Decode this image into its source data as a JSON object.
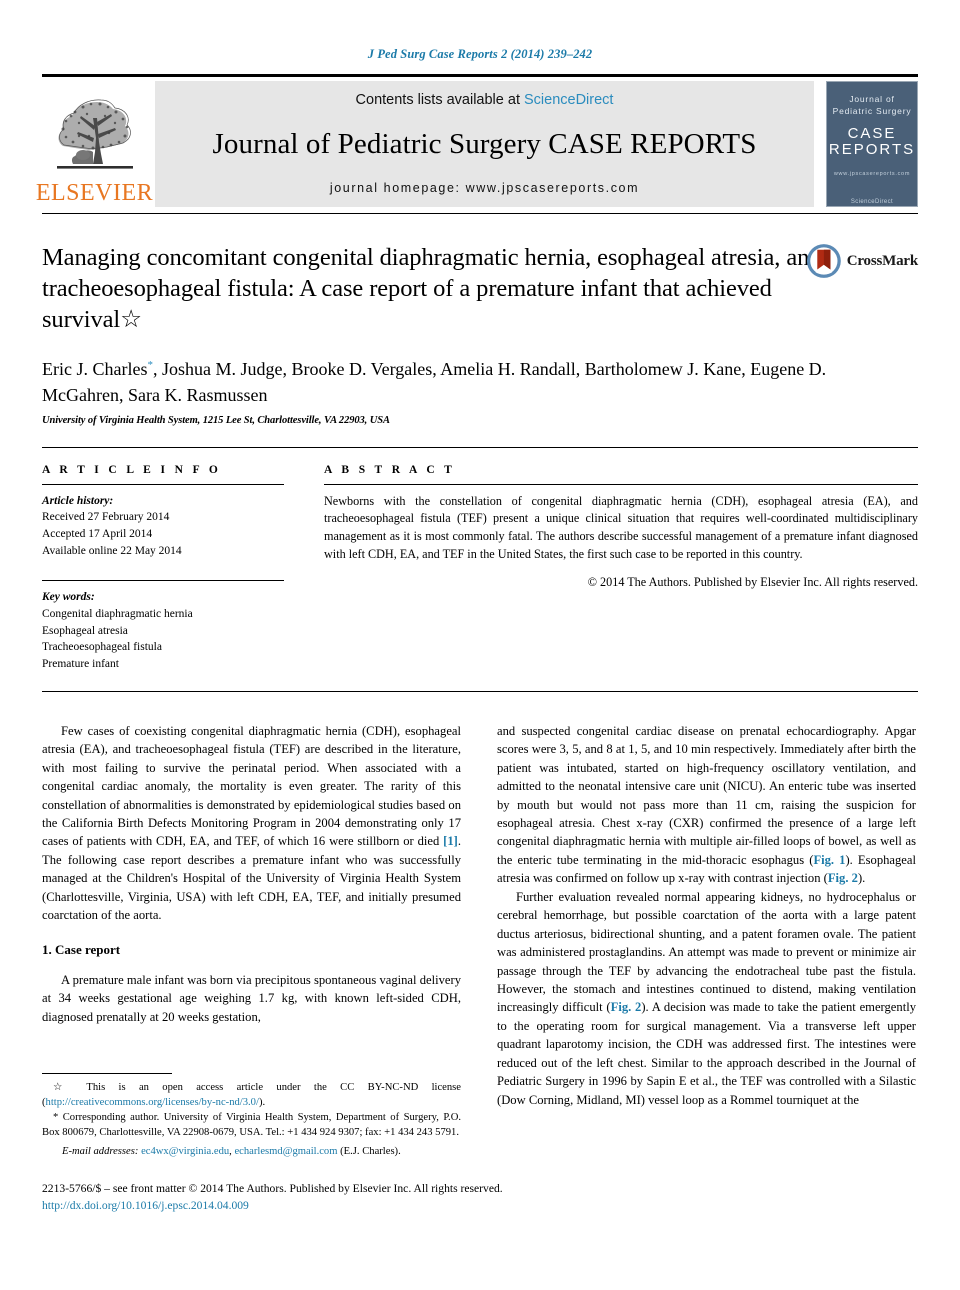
{
  "running_head": "J Ped Surg Case Reports 2 (2014) 239–242",
  "masthead": {
    "contents_prefix": "Contents lists available at ",
    "sciencedirect": "ScienceDirect",
    "journal_title": "Journal of Pediatric Surgery CASE REPORTS",
    "homepage": "journal homepage: www.jpscasereports.com",
    "publisher_name": "ELSEVIER",
    "cover": {
      "line1": "Journal of",
      "line2": "Pediatric Surgery",
      "case": "CASE",
      "reports": "REPORTS",
      "url": "www.jpscasereports.com",
      "sciencedirect": "ScienceDirect"
    },
    "accent_link_color": "#2b8cbe",
    "elsevier_orange": "#e87722",
    "cover_bg": "#4a6078"
  },
  "article": {
    "title": "Managing concomitant congenital diaphragmatic hernia, esophageal atresia, and tracheoesophageal fistula: A case report of a premature infant that achieved survival☆",
    "crossmark_label": "CrossMark",
    "authors": "Eric J. Charles*, Joshua M. Judge, Brooke D. Vergales, Amelia H. Randall, Bartholomew J. Kane, Eugene D. McGahren, Sara K. Rasmussen",
    "authors_part1": "Eric J. Charles",
    "authors_star": "*",
    "authors_part2": ", Joshua M. Judge, Brooke D. Vergales, Amelia H. Randall, Bartholomew J. Kane, Eugene D. McGahren, Sara K. Rasmussen",
    "affiliation": "University of Virginia Health System, 1215 Lee St, Charlottesville, VA 22903, USA"
  },
  "article_info": {
    "heading": "A R T I C L E  I N F O",
    "history_label": "Article history:",
    "history": [
      "Received 27 February 2014",
      "Accepted 17 April 2014",
      "Available online 22 May 2014"
    ],
    "keywords_label": "Key words:",
    "keywords": [
      "Congenital diaphragmatic hernia",
      "Esophageal atresia",
      "Tracheoesophageal fistula",
      "Premature infant"
    ]
  },
  "abstract": {
    "heading": "A B S T R A C T",
    "text": "Newborns with the constellation of congenital diaphragmatic hernia (CDH), esophageal atresia (EA), and tracheoesophageal fistula (TEF) present a unique clinical situation that requires well-coordinated multidisciplinary management as it is most commonly fatal. The authors describe successful management of a premature infant diagnosed with left CDH, EA, and TEF in the United States, the first such case to be reported in this country.",
    "copyright": "© 2014 The Authors. Published by Elsevier Inc. All rights reserved."
  },
  "body": {
    "left": {
      "para1_a": "Few cases of coexisting congenital diaphragmatic hernia (CDH), esophageal atresia (EA), and tracheoesophageal fistula (TEF) are described in the literature, with most failing to survive the perinatal period. When associated with a congenital cardiac anomaly, the mortality is even greater. The rarity of this constellation of abnormalities is demonstrated by epidemiological studies based on the California Birth Defects Monitoring Program in 2004 demonstrating only 17 cases of patients with CDH, EA, and TEF, of which 16 were stillborn or died ",
      "ref1": "[1]",
      "para1_b": ". The following case report describes a premature infant who was successfully managed at the Children's Hospital of the University of Virginia Health System (Charlottesville, Virginia, USA) with left CDH, EA, TEF, and initially presumed coarctation of the aorta.",
      "section_heading": "1. Case report",
      "para2": "A premature male infant was born via precipitous spontaneous vaginal delivery at 34 weeks gestational age weighing 1.7 kg, with known left-sided CDH, diagnosed prenatally at 20 weeks gestation,"
    },
    "right": {
      "para1_a": "and suspected congenital cardiac disease on prenatal echocardiography. Apgar scores were 3, 5, and 8 at 1, 5, and 10 min respectively. Immediately after birth the patient was intubated, started on high-frequency oscillatory ventilation, and admitted to the neonatal intensive care unit (NICU). An enteric tube was inserted by mouth but would not pass more than 11 cm, raising the suspicion for esophageal atresia. Chest x-ray (CXR) confirmed the presence of a large left congenital diaphragmatic hernia with multiple air-filled loops of bowel, as well as the enteric tube terminating in the mid-thoracic esophagus (",
      "fig1": "Fig. 1",
      "para1_b": "). Esophageal atresia was confirmed on follow up x-ray with contrast injection (",
      "fig2": "Fig. 2",
      "para1_c": ").",
      "para2_a": "Further evaluation revealed normal appearing kidneys, no hydrocephalus or cerebral hemorrhage, but possible coarctation of the aorta with a large patent ductus arteriosus, bidirectional shunting, and a patent foramen ovale. The patient was administered prostaglandins. An attempt was made to prevent or minimize air passage through the TEF by advancing the endotracheal tube past the fistula. However, the stomach and intestines continued to distend, making ventilation increasingly difficult (",
      "fig2b": "Fig. 2",
      "para2_b": "). A decision was made to take the patient emergently to the operating room for surgical management. Via a transverse left upper quadrant laparotomy incision, the CDH was addressed first. The intestines were reduced out of the left chest. Similar to the approach described in the Journal of Pediatric Surgery in 1996 by Sapin E et al., the TEF was controlled with a Silastic (Dow Corning, Midland, MI) vessel loop as a Rommel tourniquet at the"
    }
  },
  "footnotes": {
    "license_star": "☆",
    "license_text_a": " This is an open access article under the CC BY-NC-ND license (",
    "license_url": "http://creativecommons.org/licenses/by-nc-nd/3.0/",
    "license_text_b": ").",
    "corresponding_star": "*",
    "corresponding_text": " Corresponding author. University of Virginia Health System, Department of Surgery, P.O. Box 800679, Charlottesville, VA 22908-0679, USA. Tel.: +1 434 924 9307; fax: +1 434 243 5791.",
    "email_label": "E-mail addresses:",
    "email1": "ec4wx@virginia.edu",
    "email_sep": ", ",
    "email2": "echarlesmd@gmail.com",
    "email_suffix": " (E.J. Charles)."
  },
  "bottom": {
    "issn_line": "2213-5766/$ – see front matter © 2014 The Authors. Published by Elsevier Inc. All rights reserved.",
    "doi": "http://dx.doi.org/10.1016/j.epsc.2014.04.009"
  }
}
